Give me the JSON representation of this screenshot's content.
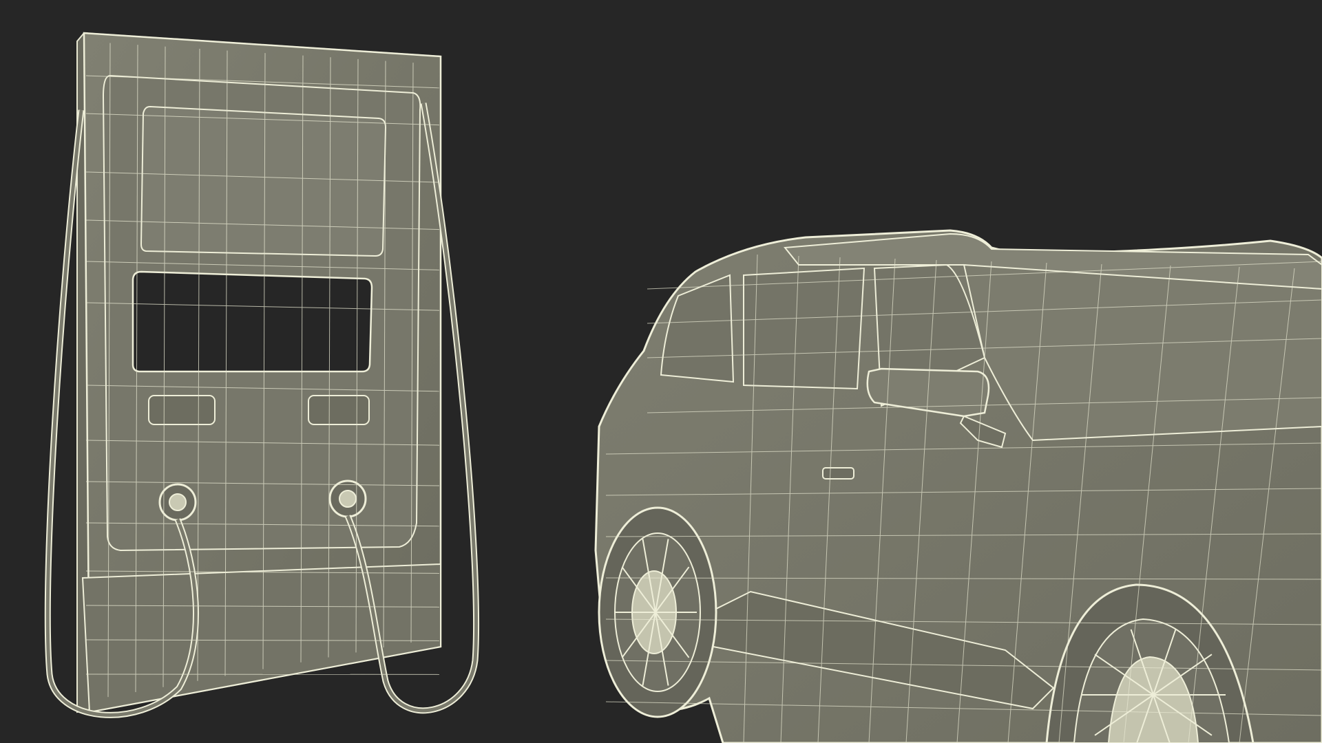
{
  "scene": {
    "background_color": "#262626",
    "surface_color": "#7a7a6c",
    "surface_shade_color": "#6f6f62",
    "wire_color": "#eeeed8",
    "wire_dim_color": "#d8d8c2",
    "window_cutout_color": "#262626",
    "objects": [
      "ev-charging-station-wireframe",
      "electric-suv-wireframe"
    ]
  }
}
